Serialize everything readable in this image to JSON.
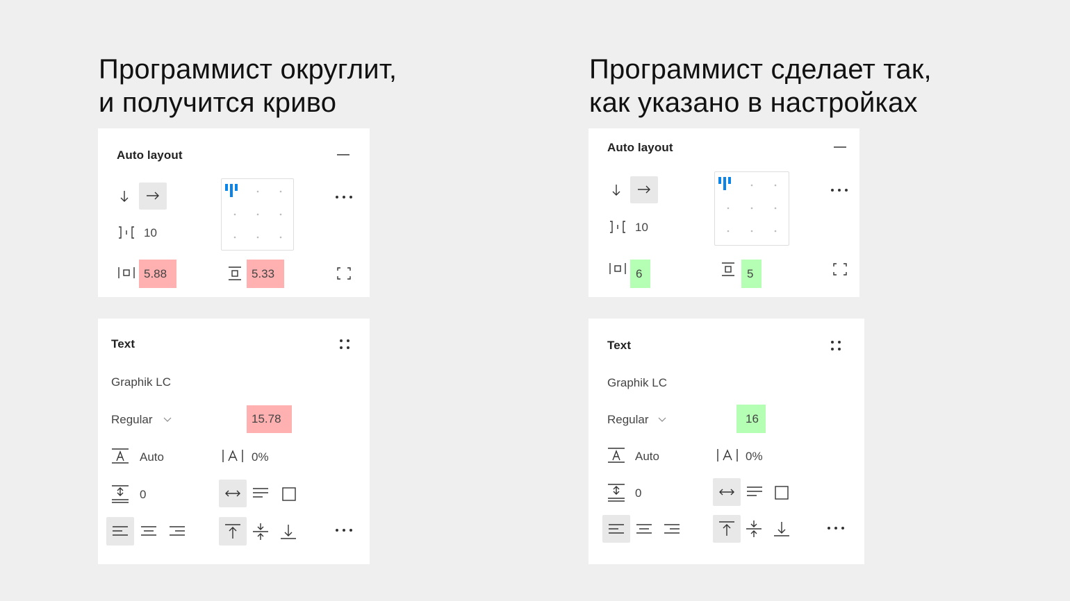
{
  "headings": {
    "left_line1": "Программист округлит,",
    "left_line2": "и получится криво",
    "right_line1": "Программист сделает так,",
    "right_line2": "как указано в настройках"
  },
  "left": {
    "auto_layout": {
      "title": "Auto layout",
      "spacing": "10",
      "padding_horizontal": "5.88",
      "padding_vertical": "5.33"
    },
    "text": {
      "title": "Text",
      "font_family": "Graphik LC",
      "font_weight": "Regular",
      "font_size": "15.78",
      "line_height": "Auto",
      "letter_spacing": "0%",
      "paragraph_spacing": "0"
    }
  },
  "right": {
    "auto_layout": {
      "title": "Auto layout",
      "spacing": "10",
      "padding_horizontal": "6",
      "padding_vertical": "5"
    },
    "text": {
      "title": "Text",
      "font_family": "Graphik LC",
      "font_weight": "Regular",
      "font_size": "16",
      "line_height": "Auto",
      "letter_spacing": "0%",
      "paragraph_spacing": "0"
    }
  },
  "colors": {
    "background": "#efefef",
    "panel": "#ffffff",
    "highlight_bad": "#ffb0b0",
    "highlight_good": "#b4ffb4",
    "accent_blue": "#0a84e8"
  }
}
